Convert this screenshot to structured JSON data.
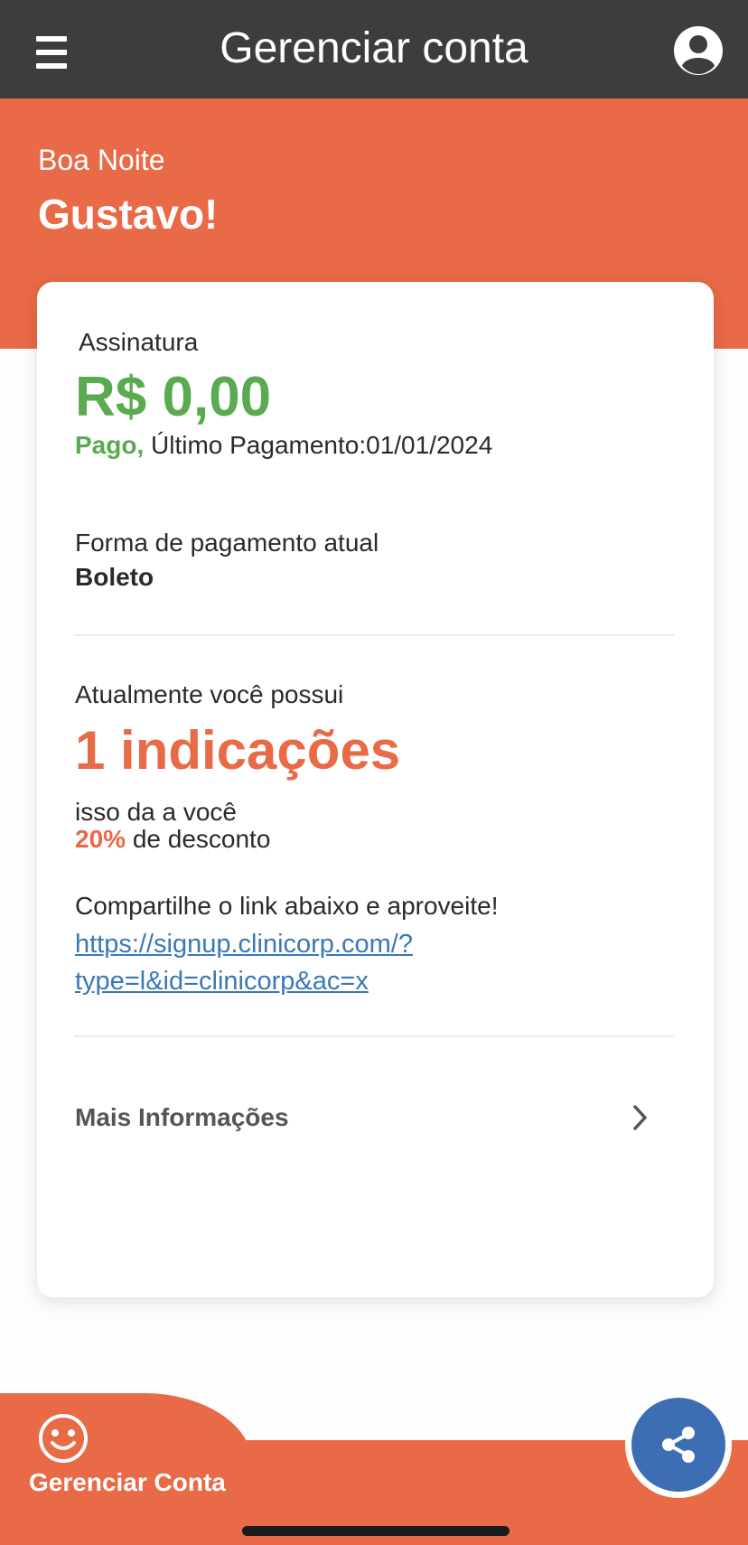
{
  "header": {
    "title": "Gerenciar conta",
    "menu_icon": "hamburger-menu-icon",
    "profile_icon": "user-circle-icon"
  },
  "greeting": {
    "salutation": "Boa Noite",
    "name": "Gustavo!"
  },
  "subscription": {
    "label": "Assinatura",
    "amount": "R$ 0,00",
    "status": "Pago,",
    "last_payment": "Último Pagamento:01/01/2024"
  },
  "payment_method": {
    "label": "Forma de pagamento atual",
    "value": "Boleto"
  },
  "referrals": {
    "intro": "Atualmente você possui",
    "count": "1 indicações",
    "benefit_line": "isso da a você",
    "discount": "20%",
    "discount_suffix": "de desconto",
    "share_text": "Compartilhe o link abaixo e aproveite!",
    "link_line1": "https://signup.clinicorp.com/?",
    "link_line2": "type=l&id=clinicorp&ac=x"
  },
  "more_info": {
    "label": "Mais Informações",
    "icon": "chevron-right-icon"
  },
  "bottom_nav": {
    "tab_label": "Gerenciar Conta",
    "tab_icon": "smiley-icon",
    "fab_icon": "share-icon"
  },
  "colors": {
    "header_bg": "#3d3d3d",
    "accent": "#e96a46",
    "success": "#5aaa4f",
    "link": "#3b78b8",
    "fab": "#3d6db3"
  }
}
